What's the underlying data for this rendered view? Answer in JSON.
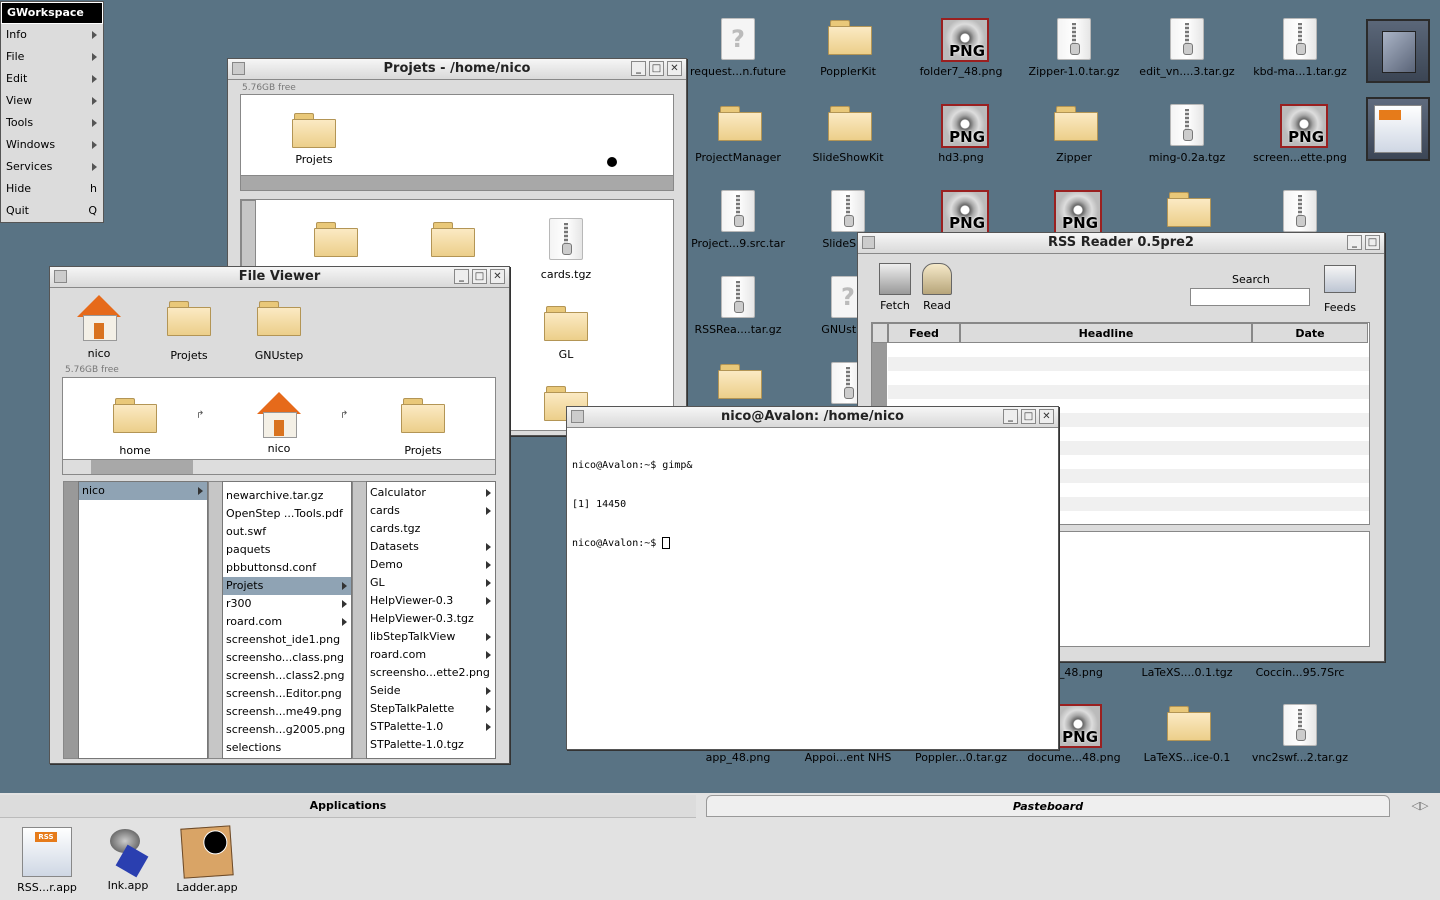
{
  "menu": {
    "title": "GWorkspace",
    "items": [
      {
        "label": "Info",
        "key": ""
      },
      {
        "label": "File",
        "key": ""
      },
      {
        "label": "Edit",
        "key": ""
      },
      {
        "label": "View",
        "key": ""
      },
      {
        "label": "Tools",
        "key": ""
      },
      {
        "label": "Windows",
        "key": ""
      },
      {
        "label": "Services",
        "key": ""
      },
      {
        "label": "Hide",
        "key": "h"
      },
      {
        "label": "Quit",
        "key": "Q"
      }
    ]
  },
  "desktop_icons": [
    {
      "label": "request...n.future",
      "type": "unknown"
    },
    {
      "label": "PopplerKit",
      "type": "folder"
    },
    {
      "label": "folder7_48.png",
      "type": "png"
    },
    {
      "label": "Zipper-1.0.tar.gz",
      "type": "zip"
    },
    {
      "label": "edit_vn....3.tar.gz",
      "type": "zip"
    },
    {
      "label": "kbd-ma...1.tar.gz",
      "type": "zip"
    },
    {
      "label": "ProjectManager",
      "type": "folder"
    },
    {
      "label": "SlideShowKit",
      "type": "folder"
    },
    {
      "label": "hd3.png",
      "type": "png"
    },
    {
      "label": "Zipper",
      "type": "folder"
    },
    {
      "label": "ming-0.2a.tgz",
      "type": "zip"
    },
    {
      "label": "screen...ette.png",
      "type": "png"
    },
    {
      "label": "Project...9.src.tar",
      "type": "zip"
    },
    {
      "label": "SlideS...1",
      "type": "zip"
    },
    {
      "label": "RSSRea....tar.gz",
      "type": "zip"
    },
    {
      "label": "GNUst...U",
      "type": "unknown"
    },
    {
      "label": "e2_48.png",
      "type": "png"
    },
    {
      "label": "LaTeXS....0.1.tgz",
      "type": "zip"
    },
    {
      "label": "Coccin...95.7Src",
      "type": "zip"
    },
    {
      "label": "app_48.png",
      "type": "png"
    },
    {
      "label": "Appoi...ent NHS",
      "type": "zip"
    },
    {
      "label": "Poppler...0.tar.gz",
      "type": "zip"
    },
    {
      "label": "docume...48.png",
      "type": "png"
    },
    {
      "label": "LaTeXS...ice-0.1",
      "type": "folder"
    },
    {
      "label": "vnc2swf...2.tar.gz",
      "type": "zip"
    }
  ],
  "projets_window": {
    "title": "Projets - /home/nico",
    "free": "5.76GB free",
    "path_icon": "Projets",
    "icons": [
      {
        "label": "",
        "type": "folder"
      },
      {
        "label": "",
        "type": "folder"
      },
      {
        "label": "cards.tgz",
        "type": "zip"
      },
      {
        "label": "GL",
        "type": "folder"
      }
    ]
  },
  "fileviewer": {
    "title": "File Viewer",
    "free": "5.76GB free",
    "shelf": [
      {
        "label": "nico",
        "type": "home"
      },
      {
        "label": "Projets",
        "type": "folder"
      },
      {
        "label": "GNUstep",
        "type": "folder"
      }
    ],
    "path": [
      {
        "label": "home",
        "type": "folder"
      },
      {
        "label": "nico",
        "type": "home"
      },
      {
        "label": "Projets",
        "type": "folder"
      }
    ],
    "col1": [
      {
        "label": "nico",
        "arrow": true,
        "selected": true
      }
    ],
    "col2": [
      {
        "label": "newarchive.tar.gz",
        "arrow": false,
        "selected": false
      },
      {
        "label": "OpenStep ...Tools.pdf",
        "arrow": false,
        "selected": false
      },
      {
        "label": "out.swf",
        "arrow": false,
        "selected": false
      },
      {
        "label": "paquets",
        "arrow": false,
        "selected": false
      },
      {
        "label": "pbbuttonsd.conf",
        "arrow": false,
        "selected": false
      },
      {
        "label": "Projets",
        "arrow": true,
        "selected": true
      },
      {
        "label": "r300",
        "arrow": true,
        "selected": false
      },
      {
        "label": "roard.com",
        "arrow": true,
        "selected": false
      },
      {
        "label": "screenshot_ide1.png",
        "arrow": false,
        "selected": false
      },
      {
        "label": "screensho...class.png",
        "arrow": false,
        "selected": false
      },
      {
        "label": "screensh...class2.png",
        "arrow": false,
        "selected": false
      },
      {
        "label": "screensh...Editor.png",
        "arrow": false,
        "selected": false
      },
      {
        "label": "screensh...me49.png",
        "arrow": false,
        "selected": false
      },
      {
        "label": "screensh...g2005.png",
        "arrow": false,
        "selected": false
      },
      {
        "label": "selections",
        "arrow": false,
        "selected": false
      }
    ],
    "col3": [
      {
        "label": "Calculator",
        "arrow": true,
        "selected": false
      },
      {
        "label": "cards",
        "arrow": true,
        "selected": false
      },
      {
        "label": "cards.tgz",
        "arrow": false,
        "selected": false
      },
      {
        "label": "Datasets",
        "arrow": true,
        "selected": false
      },
      {
        "label": "Demo",
        "arrow": true,
        "selected": false
      },
      {
        "label": "GL",
        "arrow": true,
        "selected": false
      },
      {
        "label": "HelpViewer-0.3",
        "arrow": true,
        "selected": false
      },
      {
        "label": "HelpViewer-0.3.tgz",
        "arrow": false,
        "selected": false
      },
      {
        "label": "libStepTalkView",
        "arrow": true,
        "selected": false
      },
      {
        "label": "roard.com",
        "arrow": true,
        "selected": false
      },
      {
        "label": "screensho...ette2.png",
        "arrow": false,
        "selected": false
      },
      {
        "label": "Seide",
        "arrow": true,
        "selected": false
      },
      {
        "label": "StepTalkPalette",
        "arrow": true,
        "selected": false
      },
      {
        "label": "STPalette-1.0",
        "arrow": true,
        "selected": false
      },
      {
        "label": "STPalette-1.0.tgz",
        "arrow": false,
        "selected": false
      }
    ]
  },
  "rss": {
    "title": "RSS Reader 0.5pre2",
    "fetch": "Fetch",
    "read": "Read",
    "search_label": "Search",
    "search_value": "",
    "feeds": "Feeds",
    "columns": [
      "Feed",
      "Headline",
      "Date"
    ]
  },
  "terminal": {
    "title": "nico@Avalon: /home/nico",
    "lines": [
      "nico@Avalon:~$ gimp&",
      "[1] 14450",
      "nico@Avalon:~$ "
    ]
  },
  "shelf": {
    "applications_tab": "Applications",
    "pasteboard_tab": "Pasteboard",
    "apps": [
      "RSS...r.app",
      "Ink.app",
      "Ladder.app"
    ]
  },
  "colors": {
    "desktop": "#597384",
    "selection": "#8fa3b4",
    "png_border": "#9a2020"
  }
}
